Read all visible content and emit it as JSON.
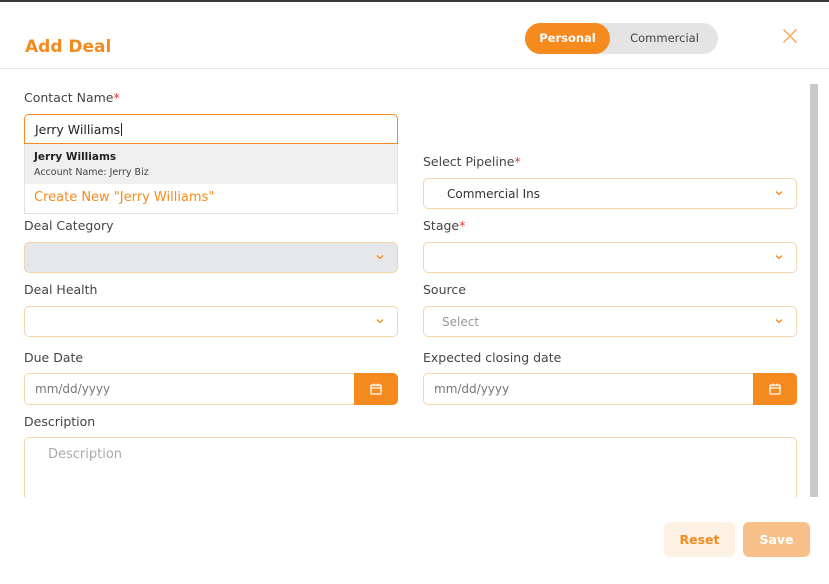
{
  "modal": {
    "title": "Add Deal",
    "toggle": {
      "active": "Personal",
      "inactive": "Commercial"
    }
  },
  "contact": {
    "label": "Contact Name",
    "required": "*",
    "value": "Jerry Williams",
    "dropdown": {
      "name": "Jerry Williams",
      "sub": "Account Name: Jerry Biz",
      "create": "Create New \"Jerry Williams\""
    }
  },
  "pipeline": {
    "label": "Select Pipeline",
    "required": "*",
    "value": "Commercial Ins"
  },
  "deal_category": {
    "label": "Deal Category"
  },
  "stage": {
    "label": "Stage",
    "required": "*"
  },
  "deal_health": {
    "label": "Deal Health"
  },
  "source": {
    "label": "Source",
    "placeholder": "Select"
  },
  "due_date": {
    "label": "Due Date",
    "placeholder": "mm/dd/yyyy"
  },
  "closing_date": {
    "label": "Expected closing date",
    "placeholder": "mm/dd/yyyy"
  },
  "description": {
    "label": "Description",
    "placeholder": "Description"
  },
  "footer": {
    "reset": "Reset",
    "save": "Save"
  },
  "colors": {
    "accent": "#f58a1f",
    "required": "#e53935",
    "field_border": "#f4d3ad",
    "disabled_bg": "#e6e7ea"
  }
}
